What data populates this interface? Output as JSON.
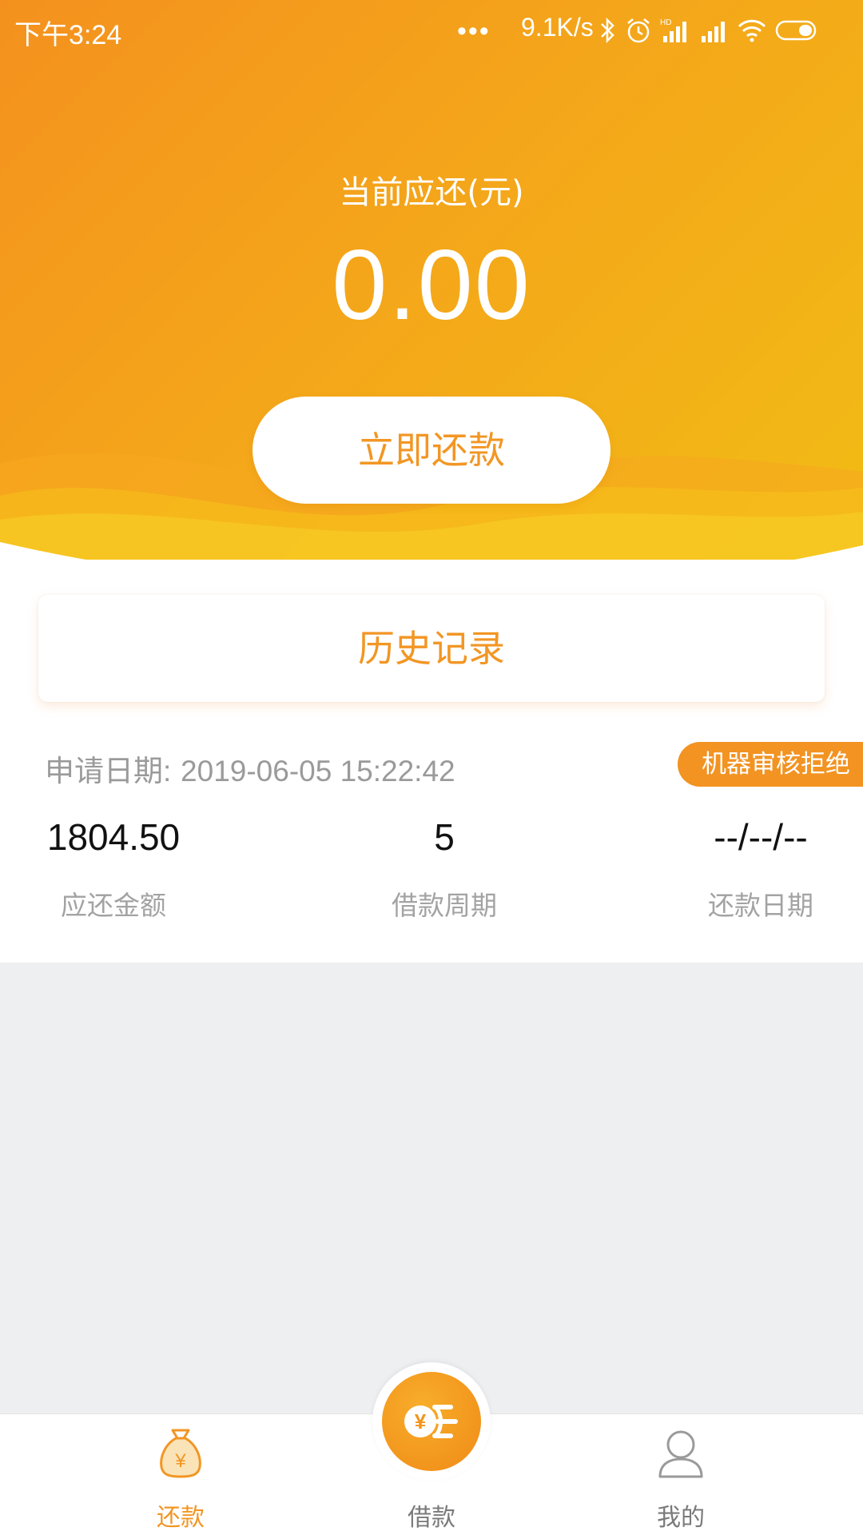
{
  "status_bar": {
    "time": "下午3:24",
    "dots": "•••",
    "net_speed": "9.1K/s"
  },
  "header": {
    "due_label": "当前应还(元)",
    "due_amount": "0.00",
    "repay_button": "立即还款",
    "gradient_colors": [
      "#f4911e",
      "#f1bd14"
    ]
  },
  "history": {
    "label": "历史记录"
  },
  "record": {
    "apply_date_label": "申请日期:",
    "apply_date_value": "2019-06-05 15:22:42",
    "status": "机器审核拒绝",
    "stats": [
      {
        "value": "1804.50",
        "label": "应还金额"
      },
      {
        "value": "5",
        "label": "借款周期"
      },
      {
        "value": "--/--/--",
        "label": "还款日期"
      }
    ]
  },
  "tabbar": {
    "tabs": [
      {
        "label": "还款",
        "icon": "money-bag-icon",
        "active": true
      },
      {
        "label": "借款",
        "icon": "coin-transfer-icon",
        "active": false
      },
      {
        "label": "我的",
        "icon": "user-icon",
        "active": false
      }
    ],
    "accent": "#f29624"
  }
}
